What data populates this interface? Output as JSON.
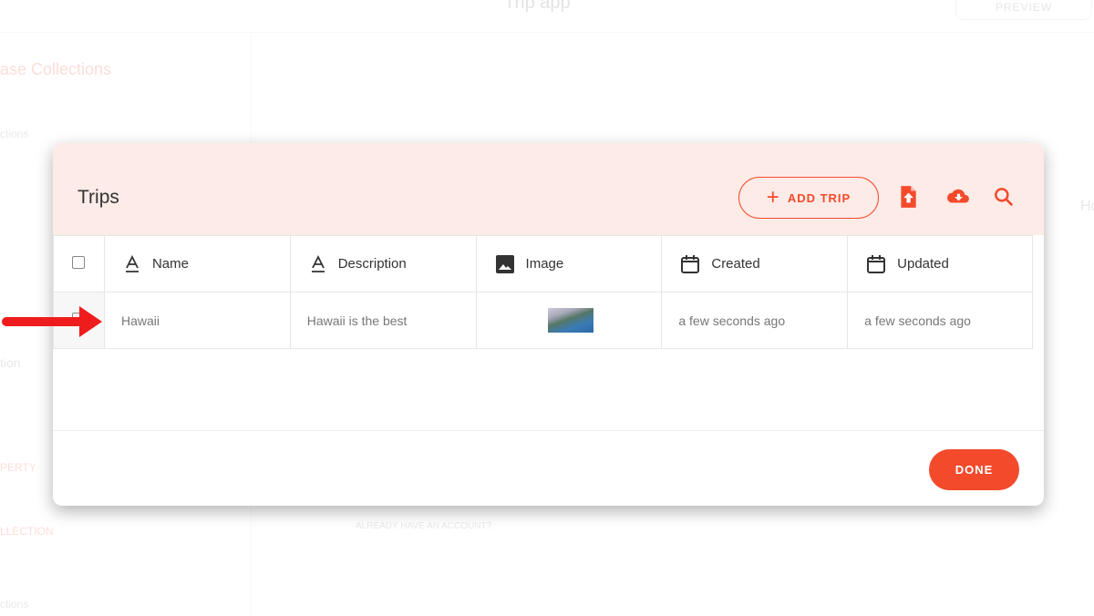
{
  "background": {
    "app_title": "Trip app",
    "preview_label": "PREVIEW",
    "sidebar_texts": [
      "ase Collections",
      "ctions",
      "tion",
      "PERTY",
      "LLECTION",
      "ctions"
    ],
    "signin_text": "ALREADY HAVE AN ACCOUNT?",
    "right_label": "Ho"
  },
  "modal": {
    "title": "Trips",
    "add_label": "ADD TRIP",
    "icons": [
      "file-upload-icon",
      "cloud-download-icon",
      "search-icon"
    ],
    "columns": [
      {
        "label": "Name",
        "icon": "text-icon"
      },
      {
        "label": "Description",
        "icon": "text-icon"
      },
      {
        "label": "Image",
        "icon": "image-icon"
      },
      {
        "label": "Created",
        "icon": "calendar-icon"
      },
      {
        "label": "Updated",
        "icon": "calendar-icon"
      }
    ],
    "rows": [
      {
        "name": "Hawaii",
        "description": "Hawaii is the best",
        "image": "thumbnail",
        "created": "a few seconds ago",
        "updated": "a few seconds ago"
      }
    ],
    "done_label": "DONE"
  },
  "colors": {
    "accent": "#f44a2c",
    "header_bg": "#fdebe7",
    "arrow": "#ee1c1c"
  }
}
